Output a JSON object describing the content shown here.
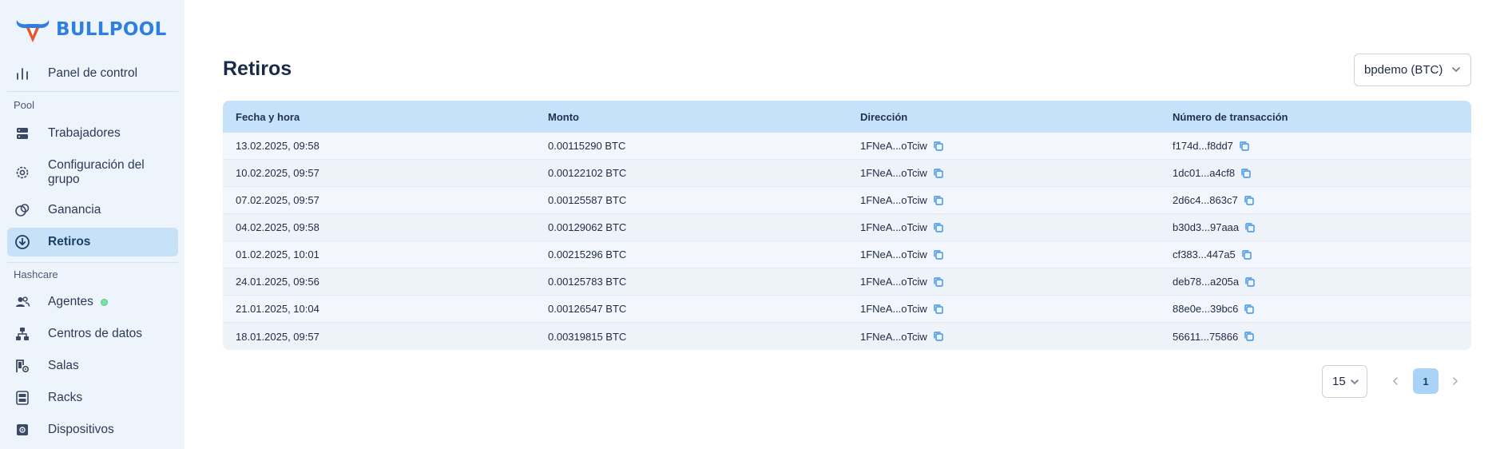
{
  "brand": {
    "name": "BULLPOOL",
    "accent": "#2f7fe0",
    "horn_color": "#e4572e"
  },
  "sidebar": {
    "top_item": {
      "label": "Panel de control",
      "icon": "bar-chart-icon"
    },
    "section_pool": "Pool",
    "pool_items": [
      {
        "label": "Trabajadores",
        "icon": "server-icon"
      },
      {
        "label": "Configuración del grupo",
        "icon": "gear-icon"
      },
      {
        "label": "Ganancia",
        "icon": "coins-icon"
      },
      {
        "label": "Retiros",
        "icon": "download-circle-icon",
        "active": true
      }
    ],
    "section_hashcare": "Hashcare",
    "hashcare_items": [
      {
        "label": "Agentes",
        "icon": "users-icon",
        "status": "online"
      },
      {
        "label": "Centros de datos",
        "icon": "hierarchy-icon"
      },
      {
        "label": "Salas",
        "icon": "room-settings-icon"
      },
      {
        "label": "Racks",
        "icon": "rack-icon"
      },
      {
        "label": "Dispositivos",
        "icon": "chip-icon"
      }
    ]
  },
  "page": {
    "title": "Retiros",
    "account_select": "bpdemo (BTC)"
  },
  "table": {
    "columns": [
      "Fecha y hora",
      "Monto",
      "Dirección",
      "Número de transacción"
    ],
    "rows": [
      {
        "date": "13.02.2025, 09:58",
        "amount": "0.00115290 BTC",
        "address": "1FNeA...oTciw",
        "tx": "f174d...f8dd7"
      },
      {
        "date": "10.02.2025, 09:57",
        "amount": "0.00122102 BTC",
        "address": "1FNeA...oTciw",
        "tx": "1dc01...a4cf8"
      },
      {
        "date": "07.02.2025, 09:57",
        "amount": "0.00125587 BTC",
        "address": "1FNeA...oTciw",
        "tx": "2d6c4...863c7"
      },
      {
        "date": "04.02.2025, 09:58",
        "amount": "0.00129062 BTC",
        "address": "1FNeA...oTciw",
        "tx": "b30d3...97aaa"
      },
      {
        "date": "01.02.2025, 10:01",
        "amount": "0.00215296 BTC",
        "address": "1FNeA...oTciw",
        "tx": "cf383...447a5"
      },
      {
        "date": "24.01.2025, 09:56",
        "amount": "0.00125783 BTC",
        "address": "1FNeA...oTciw",
        "tx": "deb78...a205a"
      },
      {
        "date": "21.01.2025, 10:04",
        "amount": "0.00126547 BTC",
        "address": "1FNeA...oTciw",
        "tx": "88e0e...39bc6"
      },
      {
        "date": "18.01.2025, 09:57",
        "amount": "0.00319815 BTC",
        "address": "1FNeA...oTciw",
        "tx": "56611...75866"
      }
    ]
  },
  "pagination": {
    "page_size": "15",
    "current_page": "1"
  }
}
